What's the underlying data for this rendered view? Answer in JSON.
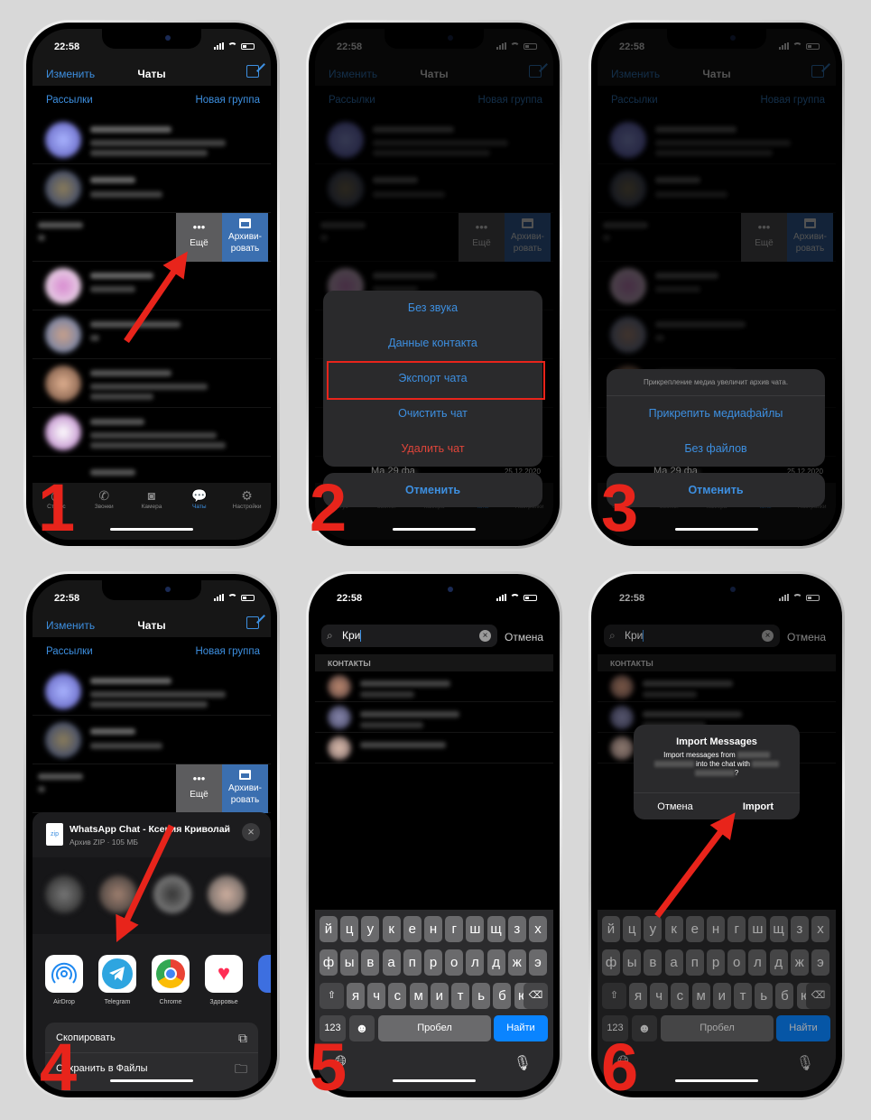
{
  "status": {
    "time": "22:58"
  },
  "chats": {
    "edit": "Изменить",
    "title": "Чаты",
    "broadcasts": "Рассылки",
    "new_group": "Новая группа",
    "swipe_more": "Ещё",
    "swipe_archive": "Архиви-\nровать",
    "peek_name": "Ма 29 фа",
    "peek_date": "25.12.2020",
    "tabs": [
      {
        "label": "Статус",
        "icon": "status-icon"
      },
      {
        "label": "Звонки",
        "icon": "phone-icon"
      },
      {
        "label": "Камера",
        "icon": "camera-icon"
      },
      {
        "label": "Чаты",
        "icon": "chats-icon",
        "active": true
      },
      {
        "label": "Настройки",
        "icon": "gear-icon"
      }
    ]
  },
  "step2": {
    "items": [
      "Без звука",
      "Данные контакта",
      "Экспорт чата",
      "Очистить чат",
      "Удалить чат"
    ],
    "cancel": "Отменить"
  },
  "step3": {
    "note": "Прикрепление медиа увеличит архив чата.",
    "items": [
      "Прикрепить медиафайлы",
      "Без файлов"
    ],
    "cancel": "Отменить"
  },
  "step4": {
    "file_icon": "zip",
    "file_title": "WhatsApp Chat - Ксения Криволай",
    "file_sub": "Архив ZIP · 105 МБ",
    "apps": [
      "AirDrop",
      "Telegram",
      "Chrome",
      "Здоровье"
    ],
    "actions": [
      "Скопировать",
      "Сохранить в Файлы"
    ]
  },
  "search": {
    "query": "Кри",
    "cancel": "Отмена",
    "section": "КОНТАКТЫ"
  },
  "keyboard": {
    "rows": [
      [
        "й",
        "ц",
        "у",
        "к",
        "е",
        "н",
        "г",
        "ш",
        "щ",
        "з",
        "х"
      ],
      [
        "ф",
        "ы",
        "в",
        "а",
        "п",
        "р",
        "о",
        "л",
        "д",
        "ж",
        "э"
      ],
      [
        "я",
        "ч",
        "с",
        "м",
        "и",
        "т",
        "ь",
        "б",
        "ю"
      ]
    ],
    "num": "123",
    "space": "Пробел",
    "go": "Найти"
  },
  "step6": {
    "title": "Import Messages",
    "msg_a": "Import messages from",
    "msg_b": "into the chat with",
    "msg_c": "?",
    "cancel": "Отмена",
    "ok": "Import"
  },
  "steps": [
    "1",
    "2",
    "3",
    "4",
    "5",
    "6"
  ],
  "colors": {
    "accent": "#3d8fe0",
    "destructive": "#e0453a",
    "annotation": "#e8241b",
    "keyboard_go": "#0a84ff"
  }
}
